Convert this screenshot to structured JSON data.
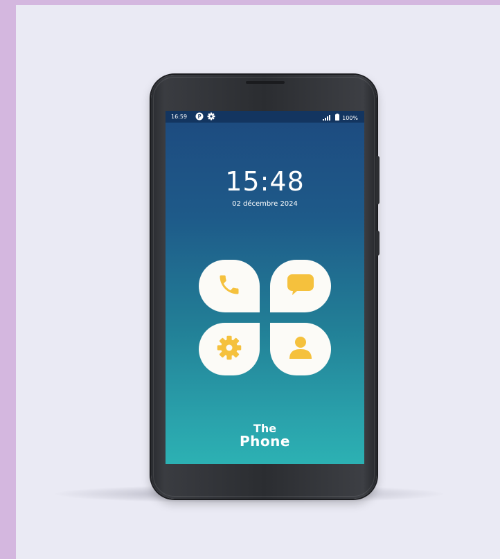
{
  "status_bar": {
    "time": "16:59",
    "battery": "100%",
    "icons": [
      "p-badge-icon",
      "settings-gear-icon",
      "signal-icon",
      "battery-icon"
    ]
  },
  "lock_screen": {
    "clock": "15:48",
    "date": "02 décembre 2024"
  },
  "apps": [
    {
      "name": "call",
      "icon": "phone-handset-icon"
    },
    {
      "name": "messages",
      "icon": "chat-bubble-icon"
    },
    {
      "name": "settings",
      "icon": "gear-icon"
    },
    {
      "name": "contacts",
      "icon": "person-icon"
    }
  ],
  "brand": {
    "line1": "The",
    "line2": "Phone"
  },
  "colors": {
    "page_frame": "#d4b7df",
    "background": "#eaeaf4",
    "screen_top": "#1d4a7f",
    "screen_bottom": "#2cb1b3",
    "tile": "#fcfbf7",
    "icon_accent": "#f5c13d"
  }
}
